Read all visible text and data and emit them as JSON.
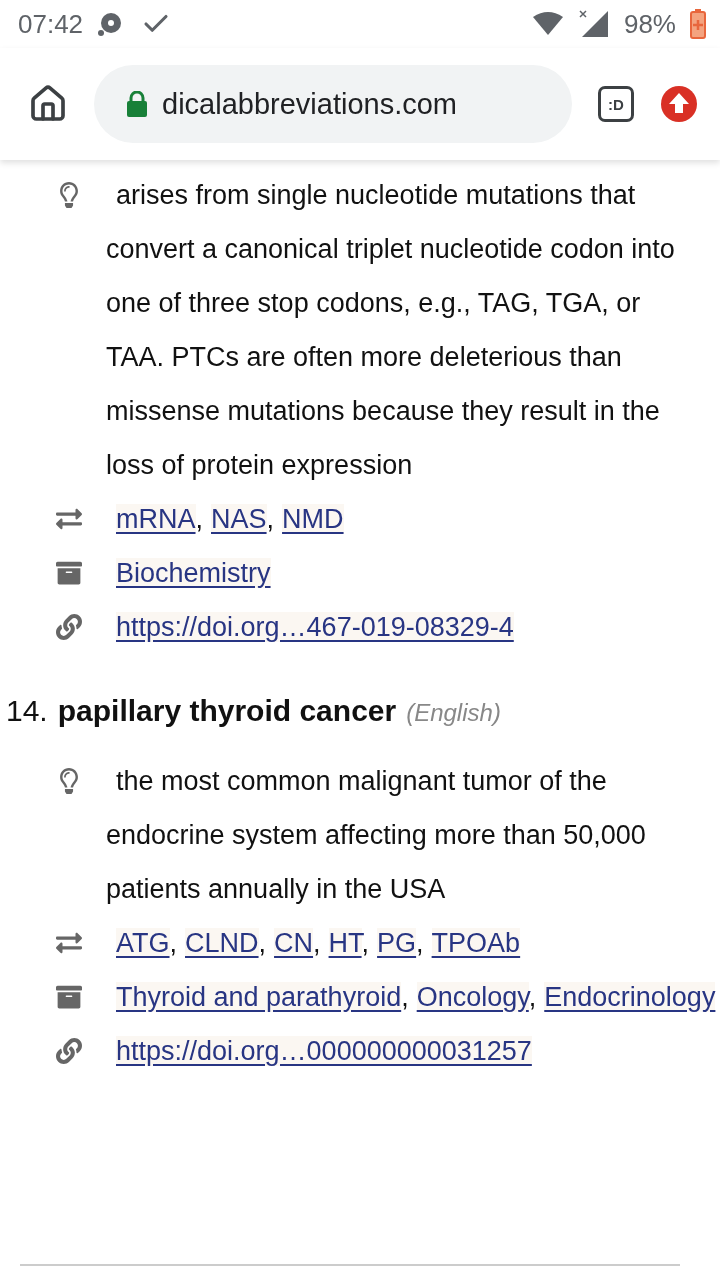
{
  "status_bar": {
    "time": "07:42",
    "battery": "98%"
  },
  "browser": {
    "url": "dicalabbreviations.com",
    "extension_label": ":D"
  },
  "separator": ",",
  "entries": [
    {
      "definition": "arises from single nucleotide mutations that convert a canonical triplet nucleotide codon into one of three stop codons, e.g., TAG, TGA, or TAA. PTCs are often more deleterious than missense mutations because they result in the loss of protein expression",
      "synonyms": [
        "mRNA",
        "NAS",
        "NMD"
      ],
      "categories": [
        "Biochemistry"
      ],
      "source": "https://doi.org…467-019-08329-4"
    },
    {
      "number": "14.",
      "term": "papillary thyroid cancer",
      "language": "(English)",
      "definition": "the most common malignant tumor of the endocrine system affecting more than 50,000 patients annually in the USA",
      "synonyms": [
        "ATG",
        "CLND",
        "CN",
        "HT",
        "PG",
        "TPOAb"
      ],
      "categories": [
        "Thyroid and parathyroid",
        "Oncology",
        "Endocrinology"
      ],
      "source": "https://doi.org…000000000031257"
    }
  ]
}
